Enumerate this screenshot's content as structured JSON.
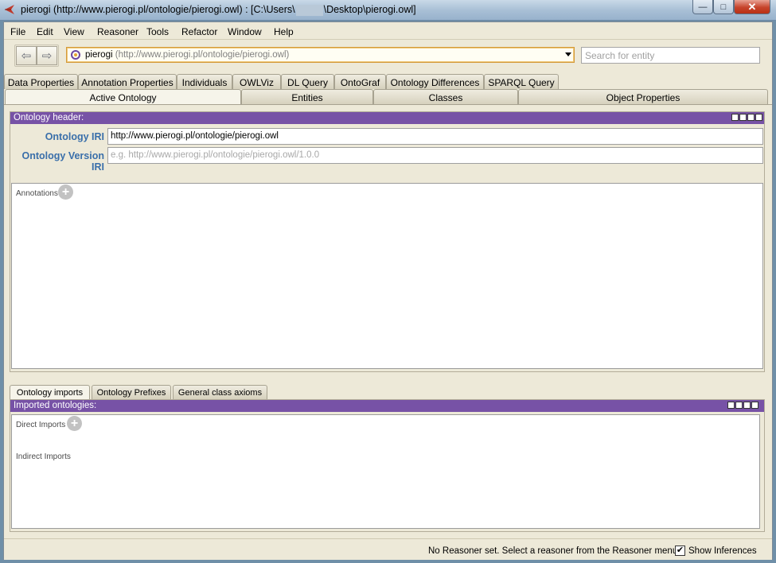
{
  "window": {
    "title_prefix": "pierogi (http://www.pierogi.pl/ontologie/pierogi.owl)  : [C:\\Users\\",
    "title_suffix": "\\Desktop\\pierogi.owl]",
    "min_glyph": "—",
    "max_glyph": "□",
    "close_glyph": "✕"
  },
  "menu": [
    "File",
    "Edit",
    "View",
    "Reasoner",
    "Tools",
    "Refactor",
    "Window",
    "Help"
  ],
  "toolbar": {
    "back_glyph": "⇦",
    "forward_glyph": "⇨",
    "ontology_name": "pierogi",
    "ontology_iri": "(http://www.pierogi.pl/ontologie/pierogi.owl)",
    "search_placeholder": "Search for entity"
  },
  "tabs_row1": [
    "Data Properties",
    "Annotation Properties",
    "Individuals",
    "OWLViz",
    "DL Query",
    "OntoGraf",
    "Ontology Differences",
    "SPARQL Query"
  ],
  "tabs_row2": [
    "Active Ontology",
    "Entities",
    "Classes",
    "Object Properties"
  ],
  "active_tab": "Active Ontology",
  "header_panel": {
    "title": "Ontology header:",
    "iri_label": "Ontology IRI",
    "iri_value": "http://www.pierogi.pl/ontologie/pierogi.owl",
    "version_label": "Ontology Version IRI",
    "version_placeholder": "e.g. http://www.pierogi.pl/ontologie/pierogi.owl/1.0.0",
    "annotations_label": "Annotations",
    "add_glyph": "+"
  },
  "bottom_tabs": [
    "Ontology imports",
    "Ontology Prefixes",
    "General class axioms"
  ],
  "imports_panel": {
    "title": "Imported ontologies:",
    "direct_label": "Direct Imports",
    "indirect_label": "Indirect Imports",
    "add_glyph": "+"
  },
  "status": {
    "message": "No Reasoner set. Select a reasoner from the Reasoner menu",
    "show_inferences_label": "Show Inferences",
    "show_inferences_checked": true,
    "check_glyph": "✔"
  },
  "colors": {
    "panel_header": "#7752a6",
    "iri_label": "#3a6faa",
    "window_bg": "#ede9d8"
  }
}
